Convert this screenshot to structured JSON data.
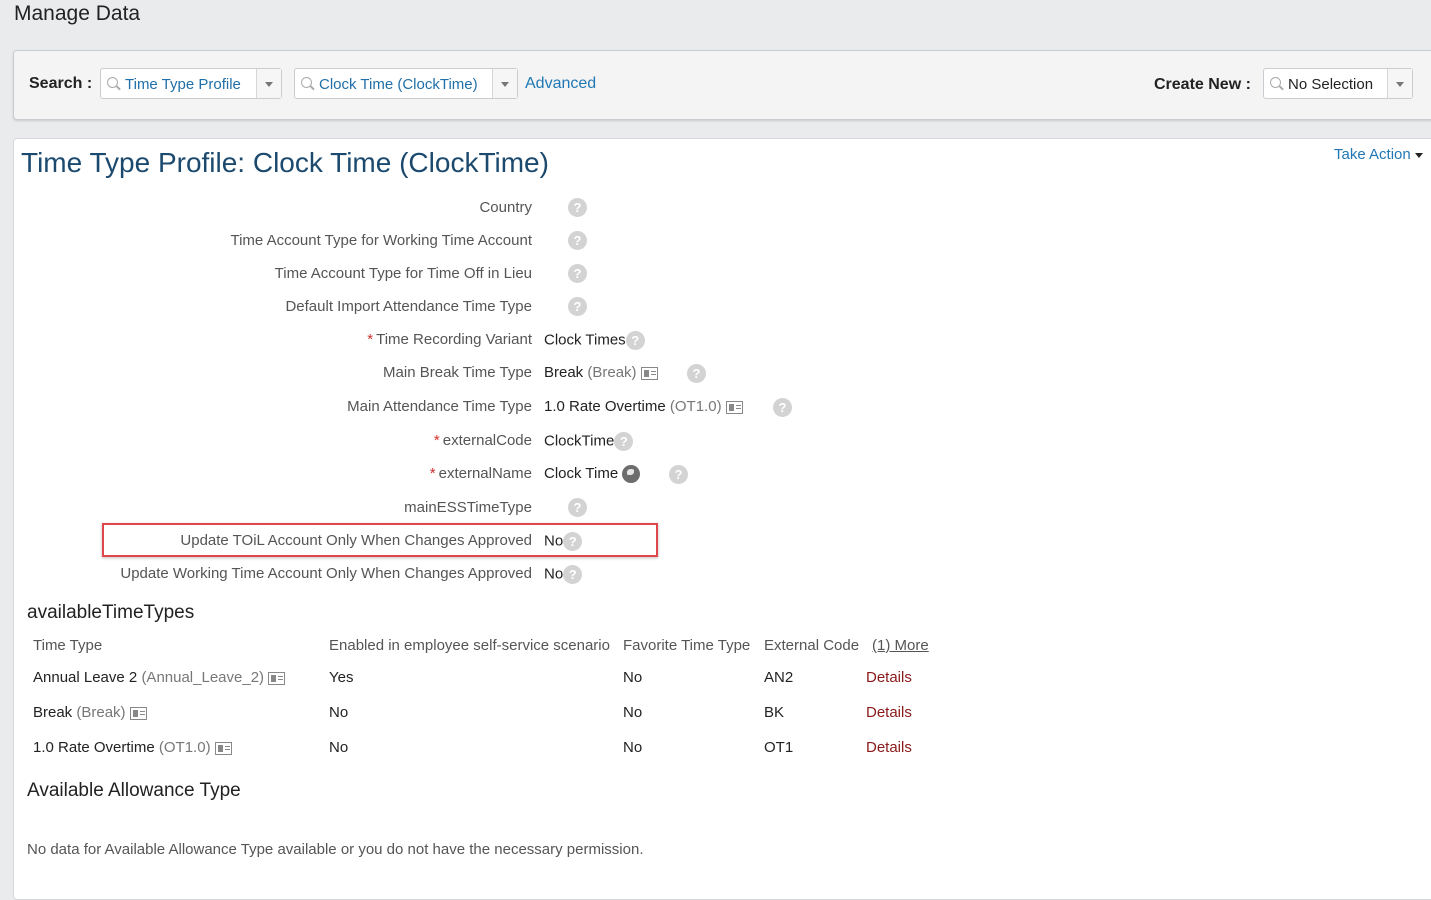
{
  "page": {
    "title": "Manage Data"
  },
  "search": {
    "label": "Search :",
    "type_value": "Time Type Profile",
    "object_value": "Clock Time (ClockTime)",
    "advanced_link": "Advanced",
    "create_label": "Create New :",
    "create_value": "No Selection"
  },
  "card": {
    "title": "Time Type Profile: Clock Time (ClockTime)",
    "take_action": "Take Action"
  },
  "fields": [
    {
      "label": "Country",
      "required": false,
      "value": "",
      "code": ""
    },
    {
      "label": "Time Account Type for Working Time Account",
      "required": false,
      "value": "",
      "code": ""
    },
    {
      "label": "Time Account Type for Time Off in Lieu",
      "required": false,
      "value": "",
      "code": ""
    },
    {
      "label": "Default Import Attendance Time Type",
      "required": false,
      "value": "",
      "code": ""
    },
    {
      "label": "Time Recording Variant",
      "required": true,
      "value": "Clock Times",
      "code": ""
    },
    {
      "label": "Main Break Time Type",
      "required": false,
      "value": "Break",
      "code": "(Break)"
    },
    {
      "label": "Main Attendance Time Type",
      "required": false,
      "value": "1.0 Rate Overtime",
      "code": "(OT1.0)"
    },
    {
      "label": "externalCode",
      "required": true,
      "value": "ClockTime",
      "code": ""
    },
    {
      "label": "externalName",
      "required": true,
      "value": "Clock Time",
      "code": ""
    },
    {
      "label": "mainESSTimeType",
      "required": false,
      "value": "",
      "code": ""
    },
    {
      "label": "Update TOiL Account Only When Changes Approved",
      "required": false,
      "value": "No",
      "code": ""
    },
    {
      "label": "Update Working Time Account Only When Changes Approved",
      "required": false,
      "value": "No",
      "code": ""
    }
  ],
  "required_marker": "*",
  "help_glyph": "?",
  "available_time_types": {
    "title": "availableTimeTypes",
    "headers": [
      "Time Type",
      "Enabled in employee self-service scenario",
      "Favorite Time Type",
      "External Code",
      "(1) More"
    ],
    "rows": [
      {
        "name": "Annual Leave 2",
        "code": "(Annual_Leave_2)",
        "enabled": "Yes",
        "favorite": "No",
        "external": "AN2",
        "action": "Details"
      },
      {
        "name": "Break",
        "code": "(Break)",
        "enabled": "No",
        "favorite": "No",
        "external": "BK",
        "action": "Details"
      },
      {
        "name": "1.0 Rate Overtime",
        "code": "(OT1.0)",
        "enabled": "No",
        "favorite": "No",
        "external": "OT1",
        "action": "Details"
      }
    ]
  },
  "allowance": {
    "title": "Available Allowance Type",
    "empty_message": "No data for Available Allowance Type available or you do not have the necessary permission."
  },
  "colors": {
    "link": "#1f78b4",
    "title": "#1c4a6e",
    "required": "#d0312d",
    "details": "#8b1a1a",
    "highlight": "#e0474c"
  }
}
